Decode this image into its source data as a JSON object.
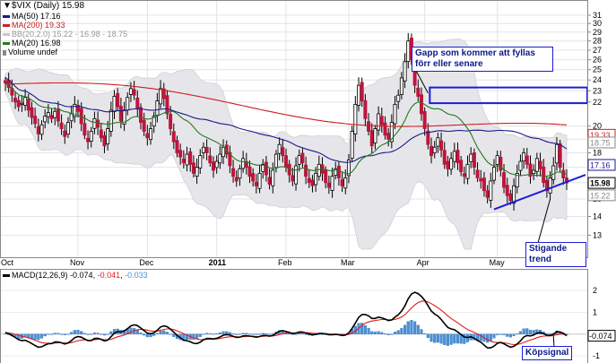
{
  "chart_data": [
    {
      "type": "candlestick",
      "panel": "price",
      "title": "$VIX (Daily) 15.98",
      "symbol": "$VIX",
      "period": "Daily",
      "last": 15.98,
      "ylim": [
        12,
        32
      ],
      "y_scale": "log",
      "y_ticks": [
        13,
        14,
        15,
        16,
        17,
        18,
        19,
        20,
        22,
        23,
        24,
        25,
        26,
        27,
        28,
        29,
        30,
        31
      ],
      "x_month_labels": [
        "Oct",
        "Nov",
        "Dec",
        "2011",
        "Feb",
        "Mar",
        "Apr",
        "May"
      ],
      "indicators": [
        {
          "name": "MA(50)",
          "value": "17.16",
          "color": "#1a1a8c"
        },
        {
          "name": "MA(200)",
          "value": "19.33",
          "color": "#cc1f1f"
        },
        {
          "name": "BB(20,2.0)",
          "value": "15.22 - 16.98 - 18.75",
          "color": "#b8b8c0"
        },
        {
          "name": "MA(20)",
          "value": "16.98",
          "color": "#1f7a1f"
        },
        {
          "name": "Volume undef",
          "value": "",
          "color": "#888888"
        }
      ],
      "price_labels": [
        {
          "value": "19.33",
          "color": "#cc1f1f"
        },
        {
          "value": "18.75",
          "color": "#888888"
        },
        {
          "value": "17.16",
          "color": "#1a1a8c"
        },
        {
          "value": "15.98",
          "color": "#000000"
        },
        {
          "value": "15.22",
          "color": "#888888"
        }
      ],
      "annotations": [
        "Gapp som kommer att fyllas förr eller senare",
        "Stigande trend"
      ],
      "gap_zone": [
        21.9,
        23.3
      ],
      "close": [
        23.7,
        23.3,
        22.6,
        22.0,
        21.6,
        21.9,
        22.4,
        21.3,
        20.7,
        20.2,
        19.4,
        20.1,
        20.8,
        21.1,
        20.6,
        21.2,
        20.4,
        19.8,
        19.2,
        20.3,
        21.0,
        21.8,
        21.2,
        20.2,
        19.3,
        18.8,
        19.6,
        20.6,
        19.9,
        19.1,
        18.5,
        19.8,
        21.3,
        22.5,
        21.6,
        20.4,
        21.3,
        22.4,
        23.2,
        22.6,
        21.4,
        20.3,
        19.6,
        19.1,
        19.8,
        20.8,
        22.1,
        23.2,
        22.3,
        21.0,
        19.8,
        18.8,
        18.0,
        17.7,
        17.3,
        17.9,
        17.2,
        16.6,
        17.0,
        17.8,
        18.4,
        18.0,
        17.3,
        16.8,
        17.4,
        17.9,
        18.4,
        17.9,
        17.1,
        16.4,
        16.1,
        16.9,
        17.6,
        17.0,
        16.4,
        16.1,
        15.8,
        16.6,
        17.2,
        16.5,
        15.9,
        16.8,
        17.9,
        18.6,
        17.8,
        17.0,
        16.5,
        16.1,
        17.1,
        17.8,
        17.3,
        16.4,
        16.0,
        15.8,
        16.6,
        17.2,
        16.6,
        16.0,
        15.7,
        16.4,
        16.9,
        16.3,
        15.8,
        16.3,
        17.5,
        19.6,
        21.8,
        23.5,
        22.1,
        20.6,
        19.6,
        18.5,
        19.8,
        21.0,
        20.1,
        19.3,
        19.0,
        20.3,
        21.8,
        22.6,
        24.2,
        25.8,
        28.0,
        26.0,
        23.5,
        22.5,
        21.0,
        19.8,
        18.6,
        17.8,
        18.4,
        19.1,
        18.2,
        17.2,
        16.9,
        17.6,
        18.1,
        17.3,
        16.7,
        16.4,
        17.2,
        17.9,
        17.0,
        16.3,
        16.1,
        15.5,
        15.1,
        16.1,
        17.0,
        17.8,
        16.8,
        15.7,
        15.2,
        14.9,
        15.8,
        16.6,
        17.4,
        18.0,
        17.2,
        16.4,
        16.8,
        17.6,
        16.9,
        16.0,
        15.5,
        16.3,
        17.1,
        18.6,
        17.0,
        16.3,
        15.98
      ]
    },
    {
      "type": "line",
      "panel": "macd",
      "title": "MACD(12,26,9) -0.074, -0.041, -0.033",
      "series": [
        {
          "name": "MACD(12,26,9)",
          "value": "-0.074",
          "color": "#000000"
        },
        {
          "name": "signal",
          "value": "-0.041",
          "color": "#e21b1b"
        },
        {
          "name": "histogram",
          "value": "-0.033",
          "color": "#4a90d9"
        }
      ],
      "ylim": [
        -1.2,
        2.5
      ],
      "y_ticks": [
        -1,
        0,
        1,
        2
      ],
      "value_label": "-0.074",
      "annotation": "Köpsignal",
      "macd": [
        0.08,
        0.02,
        -0.06,
        -0.15,
        -0.25,
        -0.3,
        -0.28,
        -0.35,
        -0.43,
        -0.52,
        -0.6,
        -0.58,
        -0.5,
        -0.44,
        -0.43,
        -0.36,
        -0.36,
        -0.4,
        -0.45,
        -0.4,
        -0.3,
        -0.16,
        -0.11,
        -0.14,
        -0.22,
        -0.3,
        -0.29,
        -0.2,
        -0.19,
        -0.24,
        -0.31,
        -0.27,
        -0.12,
        0.05,
        0.12,
        0.1,
        0.15,
        0.25,
        0.38,
        0.43,
        0.39,
        0.28,
        0.16,
        0.05,
        0.02,
        0.06,
        0.18,
        0.33,
        0.38,
        0.34,
        0.23,
        0.09,
        -0.06,
        -0.17,
        -0.28,
        -0.3,
        -0.35,
        -0.42,
        -0.43,
        -0.37,
        -0.26,
        -0.2,
        -0.2,
        -0.22,
        -0.19,
        -0.13,
        -0.05,
        -0.02,
        -0.04,
        -0.1,
        -0.15,
        -0.14,
        -0.08,
        -0.07,
        -0.09,
        -0.11,
        -0.14,
        -0.11,
        -0.06,
        -0.06,
        -0.09,
        -0.06,
        0.04,
        0.14,
        0.16,
        0.12,
        0.08,
        0.03,
        0.05,
        0.1,
        0.1,
        0.05,
        0.01,
        -0.03,
        -0.01,
        0.03,
        0.03,
        0.01,
        -0.03,
        -0.03,
        -0.01,
        -0.03,
        -0.06,
        -0.04,
        0.06,
        0.26,
        0.51,
        0.77,
        0.9,
        0.9,
        0.84,
        0.72,
        0.72,
        0.78,
        0.75,
        0.69,
        0.62,
        0.65,
        0.78,
        0.89,
        1.06,
        1.3,
        1.62,
        1.84,
        1.92,
        1.86,
        1.73,
        1.55,
        1.31,
        1.06,
        0.92,
        0.83,
        0.67,
        0.48,
        0.31,
        0.24,
        0.2,
        0.1,
        -0.02,
        -0.13,
        -0.15,
        -0.12,
        -0.19,
        -0.29,
        -0.37,
        -0.5,
        -0.63,
        -0.63,
        -0.55,
        -0.42,
        -0.38,
        -0.44,
        -0.53,
        -0.6,
        -0.56,
        -0.45,
        -0.31,
        -0.13,
        -0.06,
        -0.08,
        -0.04,
        0.05,
        0.07,
        0.02,
        -0.05,
        -0.06,
        -0.01,
        0.12,
        0.1,
        0.04,
        -0.074
      ],
      "signal": [
        0.06,
        0.05,
        0.03,
        -0.01,
        -0.05,
        -0.1,
        -0.13,
        -0.17,
        -0.22,
        -0.28,
        -0.34,
        -0.39,
        -0.41,
        -0.42,
        -0.42,
        -0.41,
        -0.4,
        -0.4,
        -0.41,
        -0.41,
        -0.39,
        -0.34,
        -0.3,
        -0.27,
        -0.26,
        -0.27,
        -0.28,
        -0.26,
        -0.24,
        -0.24,
        -0.26,
        -0.26,
        -0.24,
        -0.18,
        -0.12,
        -0.08,
        -0.04,
        0.02,
        0.09,
        0.16,
        0.2,
        0.22,
        0.21,
        0.18,
        0.15,
        0.13,
        0.14,
        0.18,
        0.22,
        0.24,
        0.24,
        0.21,
        0.15,
        0.09,
        0.02,
        -0.05,
        -0.11,
        -0.17,
        -0.22,
        -0.25,
        -0.25,
        -0.24,
        -0.23,
        -0.23,
        -0.22,
        -0.2,
        -0.17,
        -0.14,
        -0.12,
        -0.12,
        -0.12,
        -0.13,
        -0.12,
        -0.11,
        -0.1,
        -0.1,
        -0.11,
        -0.11,
        -0.1,
        -0.09,
        -0.09,
        -0.08,
        -0.06,
        -0.02,
        0.02,
        0.04,
        0.05,
        0.05,
        0.05,
        0.06,
        0.07,
        0.07,
        0.06,
        0.04,
        0.03,
        0.03,
        0.03,
        0.03,
        0.01,
        0.0,
        -0.0,
        -0.01,
        -0.02,
        -0.02,
        -0.01,
        0.04,
        0.14,
        0.27,
        0.39,
        0.5,
        0.56,
        0.6,
        0.62,
        0.65,
        0.67,
        0.67,
        0.66,
        0.66,
        0.68,
        0.72,
        0.79,
        0.89,
        1.04,
        1.2,
        1.34,
        1.45,
        1.51,
        1.52,
        1.48,
        1.4,
        1.31,
        1.21,
        1.1,
        0.97,
        0.84,
        0.72,
        0.62,
        0.52,
        0.41,
        0.31,
        0.21,
        0.15,
        0.08,
        0.0,
        -0.07,
        -0.16,
        -0.25,
        -0.33,
        -0.37,
        -0.38,
        -0.38,
        -0.4,
        -0.42,
        -0.46,
        -0.48,
        -0.47,
        -0.44,
        -0.38,
        -0.32,
        -0.27,
        -0.22,
        -0.16,
        -0.12,
        -0.09,
        -0.08,
        -0.08,
        -0.06,
        -0.03,
        -0.0,
        0.0,
        -0.041
      ]
    }
  ]
}
